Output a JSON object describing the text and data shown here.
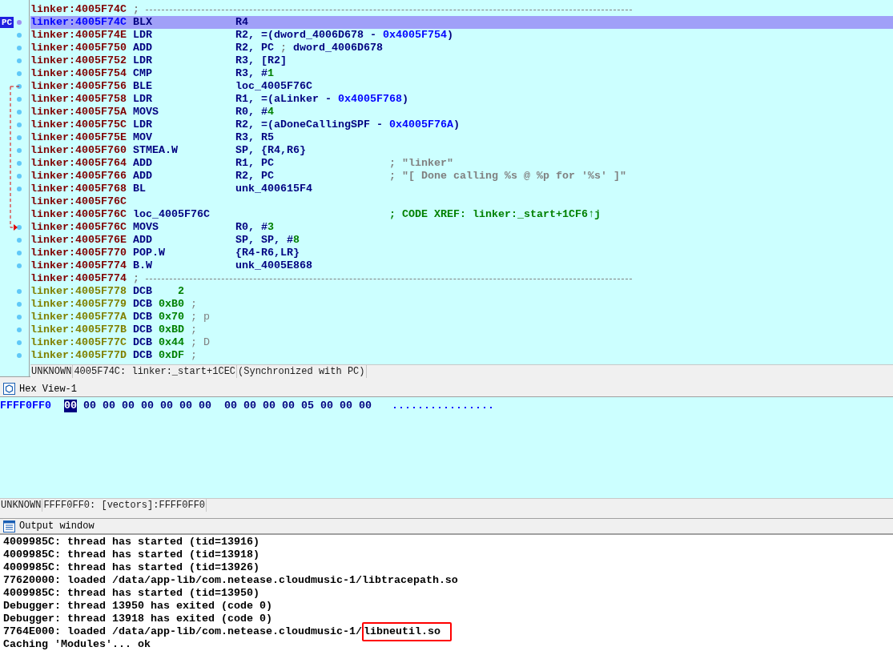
{
  "disassembly": {
    "pc_label": "PC",
    "rows": [
      {
        "kind": "separator",
        "address": "linker:4005F74C",
        "mnemonic": ";",
        "dot": false,
        "selected": false
      },
      {
        "kind": "code",
        "address": "linker:4005F74C",
        "mnemonic": "BLX",
        "operands": [
          {
            "text": "R4",
            "kind": "reg"
          }
        ],
        "dot": true,
        "selected": true
      },
      {
        "kind": "code",
        "address": "linker:4005F74E",
        "mnemonic": "LDR",
        "operands": [
          {
            "text": "R2, =(dword_4006D678 - ",
            "kind": "reg"
          },
          {
            "text": "0x4005F754",
            "kind": "num"
          },
          {
            "text": ")",
            "kind": "reg"
          }
        ],
        "dot": true,
        "selected": false
      },
      {
        "kind": "code",
        "address": "linker:4005F750",
        "mnemonic": "ADD",
        "operands": [
          {
            "text": "R2, PC ",
            "kind": "reg"
          },
          {
            "text": "; ",
            "kind": "cmt"
          },
          {
            "text": "dword_4006D678",
            "kind": "reg"
          }
        ],
        "dot": true,
        "selected": false
      },
      {
        "kind": "code",
        "address": "linker:4005F752",
        "mnemonic": "LDR",
        "operands": [
          {
            "text": "R3, [R2]",
            "kind": "reg"
          }
        ],
        "dot": true,
        "selected": false
      },
      {
        "kind": "code",
        "address": "linker:4005F754",
        "mnemonic": "CMP",
        "operands": [
          {
            "text": "R3, #",
            "kind": "reg"
          },
          {
            "text": "1",
            "kind": "imm"
          }
        ],
        "dot": true,
        "selected": false
      },
      {
        "kind": "code",
        "address": "linker:4005F756",
        "mnemonic": "BLE",
        "operands": [
          {
            "text": "loc_4005F76C",
            "kind": "reg"
          }
        ],
        "dot": true,
        "selected": false
      },
      {
        "kind": "code",
        "address": "linker:4005F758",
        "mnemonic": "LDR",
        "operands": [
          {
            "text": "R1, =(aLinker - ",
            "kind": "reg"
          },
          {
            "text": "0x4005F768",
            "kind": "num"
          },
          {
            "text": ")",
            "kind": "reg"
          }
        ],
        "dot": true,
        "selected": false
      },
      {
        "kind": "code",
        "address": "linker:4005F75A",
        "mnemonic": "MOVS",
        "operands": [
          {
            "text": "R0, #",
            "kind": "reg"
          },
          {
            "text": "4",
            "kind": "imm"
          }
        ],
        "dot": true,
        "selected": false
      },
      {
        "kind": "code",
        "address": "linker:4005F75C",
        "mnemonic": "LDR",
        "operands": [
          {
            "text": "R2, =(aDoneCallingSPF - ",
            "kind": "reg"
          },
          {
            "text": "0x4005F76A",
            "kind": "num"
          },
          {
            "text": ")",
            "kind": "reg"
          }
        ],
        "dot": true,
        "selected": false
      },
      {
        "kind": "code",
        "address": "linker:4005F75E",
        "mnemonic": "MOV",
        "operands": [
          {
            "text": "R3, R5",
            "kind": "reg"
          }
        ],
        "dot": true,
        "selected": false
      },
      {
        "kind": "code",
        "address": "linker:4005F760",
        "mnemonic": "STMEA.W",
        "operands": [
          {
            "text": "SP, {R4,R6}",
            "kind": "reg"
          }
        ],
        "dot": true,
        "selected": false
      },
      {
        "kind": "code",
        "address": "linker:4005F764",
        "mnemonic": "ADD",
        "operands": [
          {
            "text": "R1, PC",
            "kind": "reg"
          }
        ],
        "comment": {
          "text": "; \"linker\"",
          "kind": "string"
        },
        "dot": true,
        "selected": false
      },
      {
        "kind": "code",
        "address": "linker:4005F766",
        "mnemonic": "ADD",
        "operands": [
          {
            "text": "R2, PC",
            "kind": "reg"
          }
        ],
        "comment": {
          "text": "; \"[ Done calling %s @ %p for '%s' ]\"",
          "kind": "string"
        },
        "dot": true,
        "selected": false
      },
      {
        "kind": "code",
        "address": "linker:4005F768",
        "mnemonic": "BL",
        "operands": [
          {
            "text": "unk_400615F4",
            "kind": "reg"
          }
        ],
        "dot": true,
        "selected": false
      },
      {
        "kind": "blank",
        "address": "linker:4005F76C",
        "dot": false,
        "selected": false
      },
      {
        "kind": "code",
        "address": "linker:4005F76C",
        "mnemonic": "loc_4005F76C",
        "comment": {
          "text": "; CODE XREF: linker:_start+1CF6↑j",
          "kind": "xref"
        },
        "dot": false,
        "selected": false
      },
      {
        "kind": "code",
        "address": "linker:4005F76C",
        "mnemonic": "MOVS",
        "operands": [
          {
            "text": "R0, #",
            "kind": "reg"
          },
          {
            "text": "3",
            "kind": "imm"
          }
        ],
        "dot": true,
        "selected": false
      },
      {
        "kind": "code",
        "address": "linker:4005F76E",
        "mnemonic": "ADD",
        "operands": [
          {
            "text": "SP, SP, #",
            "kind": "reg"
          },
          {
            "text": "8",
            "kind": "imm"
          }
        ],
        "dot": true,
        "selected": false
      },
      {
        "kind": "code",
        "address": "linker:4005F770",
        "mnemonic": "POP.W",
        "operands": [
          {
            "text": "{R4-R6,LR}",
            "kind": "reg"
          }
        ],
        "dot": true,
        "selected": false
      },
      {
        "kind": "code",
        "address": "linker:4005F774",
        "mnemonic": "B.W",
        "operands": [
          {
            "text": "unk_4005E868",
            "kind": "reg"
          }
        ],
        "dot": true,
        "selected": false
      },
      {
        "kind": "separator",
        "address": "linker:4005F774",
        "mnemonic": ";",
        "dot": false,
        "selected": false
      },
      {
        "kind": "data",
        "address": "linker:4005F778",
        "mnemonic": "DCB",
        "value": "2",
        "dot": true,
        "selected": false
      },
      {
        "kind": "data",
        "address": "linker:4005F779",
        "mnemonic": "DCB",
        "value": "0xB0",
        "comment": {
          "text": ";",
          "kind": "data"
        },
        "dot": true,
        "selected": false
      },
      {
        "kind": "data",
        "address": "linker:4005F77A",
        "mnemonic": "DCB",
        "value": "0x70",
        "comment": {
          "text": "; p",
          "kind": "data"
        },
        "dot": true,
        "selected": false
      },
      {
        "kind": "data",
        "address": "linker:4005F77B",
        "mnemonic": "DCB",
        "value": "0xBD",
        "comment": {
          "text": ";",
          "kind": "data"
        },
        "dot": true,
        "selected": false
      },
      {
        "kind": "data",
        "address": "linker:4005F77C",
        "mnemonic": "DCB",
        "value": "0x44",
        "comment": {
          "text": "; D",
          "kind": "data"
        },
        "dot": true,
        "selected": false
      },
      {
        "kind": "data",
        "address": "linker:4005F77D",
        "mnemonic": "DCB",
        "value": "0xDF",
        "comment": {
          "text": ";",
          "kind": "data"
        },
        "dot": true,
        "selected": false
      }
    ],
    "status": [
      "UNKNOWN",
      "4005F74C: linker:_start+1CEC",
      "(Synchronized with PC)"
    ]
  },
  "hex_view": {
    "title": "Hex View-1",
    "address": "FFFF0FF0",
    "bytes": [
      {
        "text": "00",
        "selected": true
      },
      {
        "text": "00",
        "selected": false
      },
      {
        "text": "00",
        "selected": false
      },
      {
        "text": "00",
        "selected": false
      },
      {
        "text": "00",
        "selected": false
      },
      {
        "text": "00",
        "selected": false
      },
      {
        "text": "00",
        "selected": false
      },
      {
        "text": "00",
        "selected": false
      },
      {
        "text": "00",
        "selected": false
      },
      {
        "text": "00",
        "selected": false
      },
      {
        "text": "00",
        "selected": false
      },
      {
        "text": "00",
        "selected": false
      },
      {
        "text": "05",
        "selected": false
      },
      {
        "text": "00",
        "selected": false
      },
      {
        "text": "00",
        "selected": false
      },
      {
        "text": "00",
        "selected": false
      }
    ],
    "ascii": "................",
    "status": [
      "UNKNOWN",
      "FFFF0FF0: [vectors]:FFFF0FF0"
    ]
  },
  "output": {
    "title": "Output window",
    "lines": [
      {
        "text": "4009985C: thread has started (tid=13916)"
      },
      {
        "text": "4009985C: thread has started (tid=13918)"
      },
      {
        "text": "4009985C: thread has started (tid=13926)"
      },
      {
        "text": "77620000: loaded /data/app-lib/com.netease.cloudmusic-1/libtracepath.so"
      },
      {
        "text": "4009985C: thread has started (tid=13950)"
      },
      {
        "text": "Debugger: thread 13950 has exited (code 0)"
      },
      {
        "text": "Debugger: thread 13918 has exited (code 0)"
      },
      {
        "text": "7764E000: loaded /data/app-lib/com.netease.cloudmusic-1/",
        "boxed": "libneutil.so"
      },
      {
        "text": "Caching 'Modules'... ok"
      }
    ]
  }
}
